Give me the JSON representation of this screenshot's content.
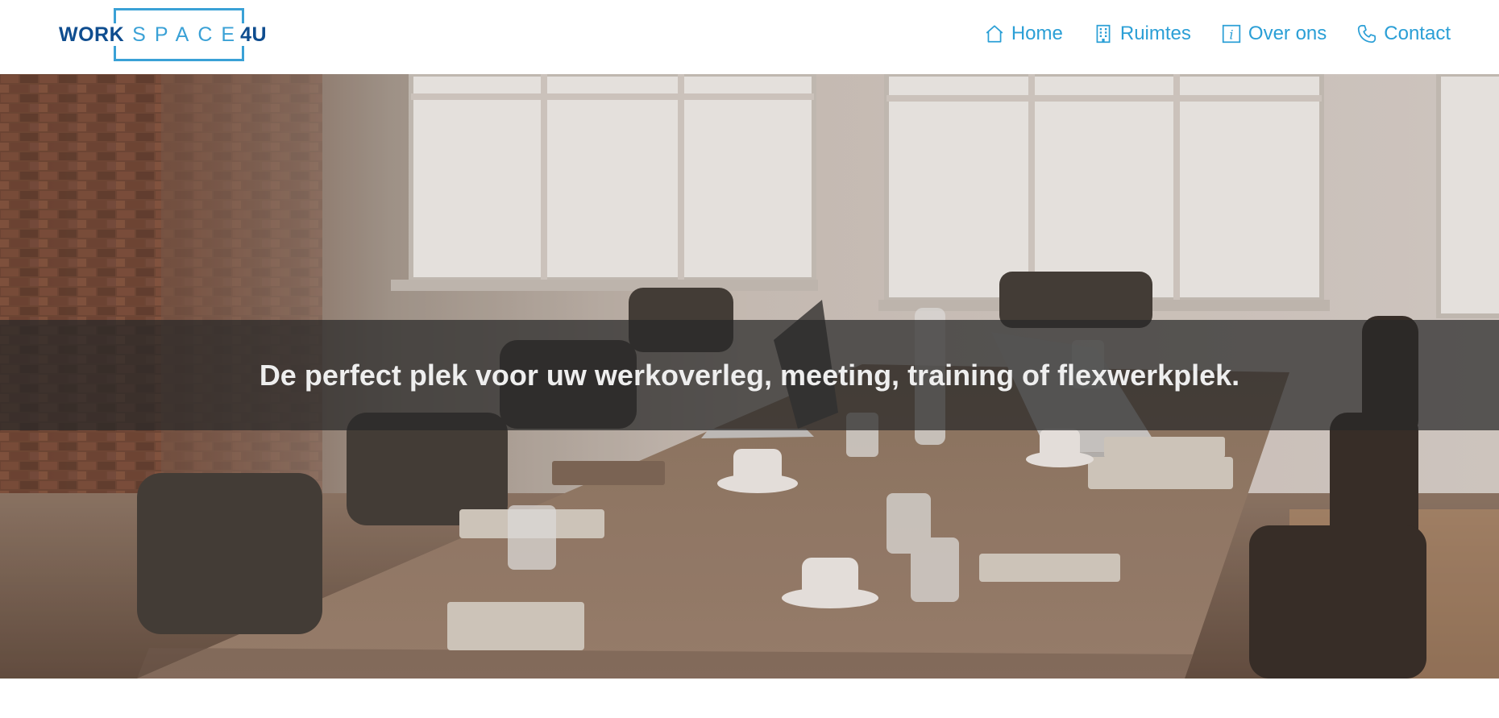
{
  "brand": {
    "work": "WORK",
    "space": "SPACE",
    "suffix": "4U",
    "colors": {
      "dark_blue": "#0f4d8f",
      "light_blue": "#3aa1d6"
    }
  },
  "nav": {
    "items": [
      {
        "label": "Home",
        "icon": "home-icon"
      },
      {
        "label": "Ruimtes",
        "icon": "building-icon"
      },
      {
        "label": "Over ons",
        "icon": "info-icon"
      },
      {
        "label": "Contact",
        "icon": "phone-icon"
      }
    ],
    "color": "#2b9fd6"
  },
  "hero": {
    "title": "De perfect plek voor uw werkoverleg, meeting, training of flexwerkplek.",
    "image": "meeting-room-photo"
  }
}
